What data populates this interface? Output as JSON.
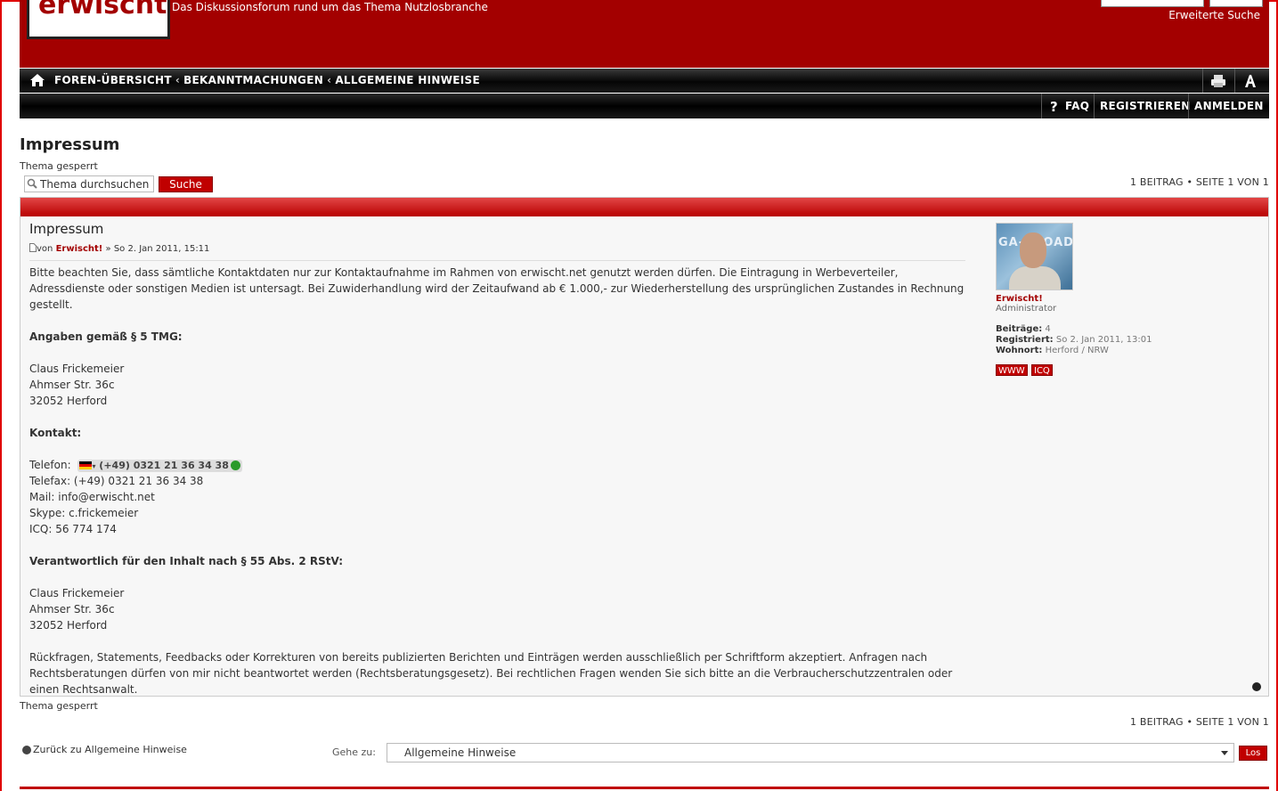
{
  "header": {
    "logo_text": "erwischt!",
    "site_description": "Das Diskussionsforum rund um das Thema Nutzlosbranche",
    "advanced_search": "Erweiterte Suche"
  },
  "breadcrumbs": [
    "FOREN-ÜBERSICHT",
    "BEKANNTMACHUNGEN",
    "ALLGEMEINE HINWEISE"
  ],
  "breadcrumb_sep": "‹",
  "subnav": {
    "faq": "FAQ",
    "register": "REGISTRIEREN",
    "login": "ANMELDEN"
  },
  "topic": {
    "title": "Impressum",
    "locked": "Thema gesperrt",
    "search_placeholder": "Thema durchsuchen",
    "search_button": "Suche",
    "pagination": "1 BEITRAG • SEITE 1 VON 1"
  },
  "post": {
    "title": "Impressum",
    "meta_prefix": "von",
    "author": "Erwischt!",
    "meta_date": "» So 2. Jan 2011, 15:11",
    "paragraph_intro": "Bitte beachten Sie, dass sämtliche Kontaktdaten nur zur Kontaktaufnahme im Rahmen von erwischt.net genutzt werden dürfen. Die Eintragung in Werbeverteiler, Adressdienste oder sonstigen Medien ist untersagt. Bei Zuwiderhandlung wird der Zeitaufwand ab € 1.000,- zur Wiederherstellung des ursprünglichen Zustandes in Rechnung gestellt.",
    "heading_tmg": "Angaben gemäß § 5 TMG:",
    "address1": [
      "Claus Frickemeier",
      "Ahmser Str. 36c",
      "32052 Herford"
    ],
    "heading_contact": "Kontakt:",
    "phone_label": "Telefon:",
    "phone_number": "(+49) 0321 21 36 34 38",
    "fax": "Telefax: (+49) 0321 21 36 34 38",
    "mail": "Mail: info@erwischt.net",
    "skype": "Skype: c.frickemeier",
    "icq": "ICQ: 56 774 174",
    "heading_responsible": "Verantwortlich für den Inhalt nach § 55 Abs. 2 RStV:",
    "address2": [
      "Claus Frickemeier",
      "Ahmser Str. 36c",
      "32052 Herford"
    ],
    "paragraph_outro": "Rückfragen, Statements, Feedbacks oder Korrekturen von bereits publizierten Berichten und Einträgen werden ausschließlich per Schriftform akzeptiert. Anfragen nach Rechtsberatungen dürfen von mir nicht beantwortet werden (Rechtsberatungsgesetz). Bei rechtlichen Fragen wenden Sie sich bitte an die Verbraucherschutzzentralen oder einen Rechtsanwalt."
  },
  "profile": {
    "avatar_text": "GA-FI  OADS",
    "name": "Erwischt!",
    "rank": "Administrator",
    "posts_label": "Beiträge:",
    "posts_value": "4",
    "registered_label": "Registriert:",
    "registered_value": "So 2. Jan 2011, 13:01",
    "location_label": "Wohnort:",
    "location_value": "Herford / NRW",
    "www_button": "WWW",
    "icq_button": "ICQ"
  },
  "footer": {
    "locked": "Thema gesperrt",
    "pagination": "1 BEITRAG • SEITE 1 VON 1",
    "back_link": "Zurück zu Allgemeine Hinweise",
    "goto_label": "Gehe zu:",
    "goto_selected": "Allgemeine Hinweise",
    "go_button": "Los"
  },
  "colors": {
    "brand_red": "#a30000",
    "button_red": "#c00000"
  }
}
